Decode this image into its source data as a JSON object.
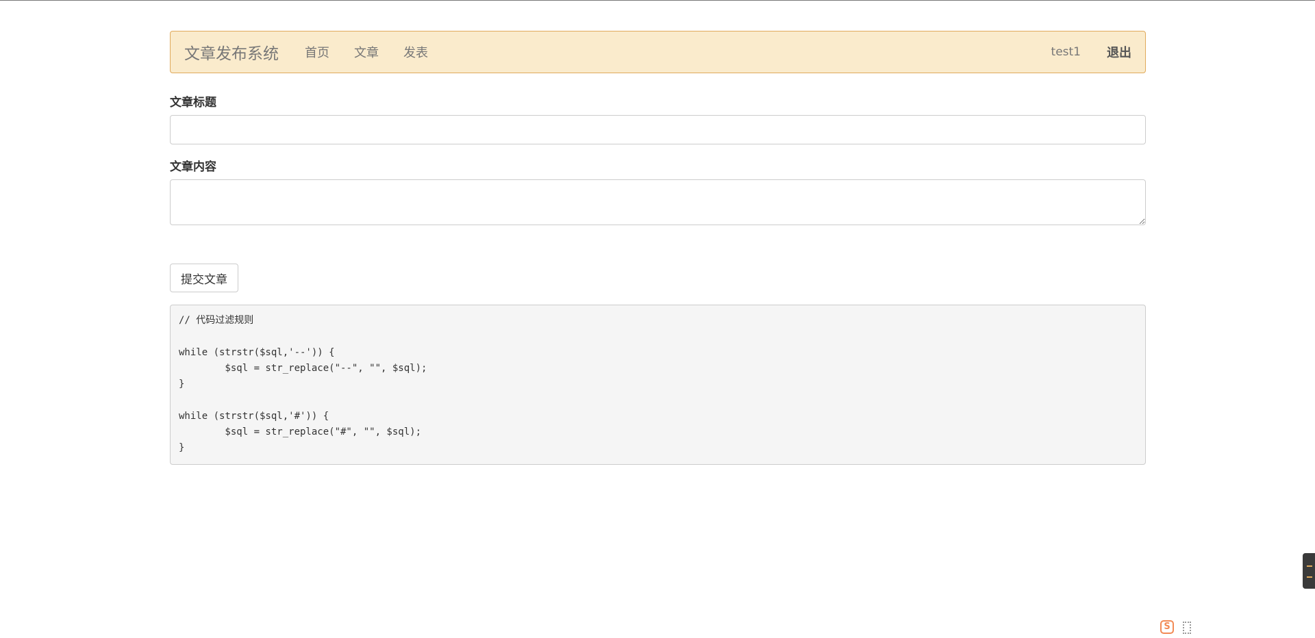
{
  "navbar": {
    "brand": "文章发布系统",
    "links": [
      "首页",
      "文章",
      "发表"
    ],
    "username": "test1",
    "logout": "退出",
    "colors": {
      "background": "#faebcc",
      "border": "#e0a95b"
    }
  },
  "form": {
    "title_label": "文章标题",
    "title_value": "",
    "content_label": "文章内容",
    "content_value": "",
    "submit_label": "提交文章"
  },
  "code": {
    "lines": [
      "// 代码过滤规则",
      "",
      "while (strstr($sql,'--')) {",
      "        $sql = str_replace(\"--\", \"\", $sql);",
      "}",
      "",
      "while (strstr($sql,'#')) {",
      "        $sql = str_replace(\"#\", \"\", $sql);",
      "}"
    ]
  },
  "widgets": {
    "corner_s_letter": "S",
    "corner_s_icon": "sohu-input-icon",
    "expand_icon": "expand-icon",
    "side_panel_icon": "side-panel-icon"
  }
}
